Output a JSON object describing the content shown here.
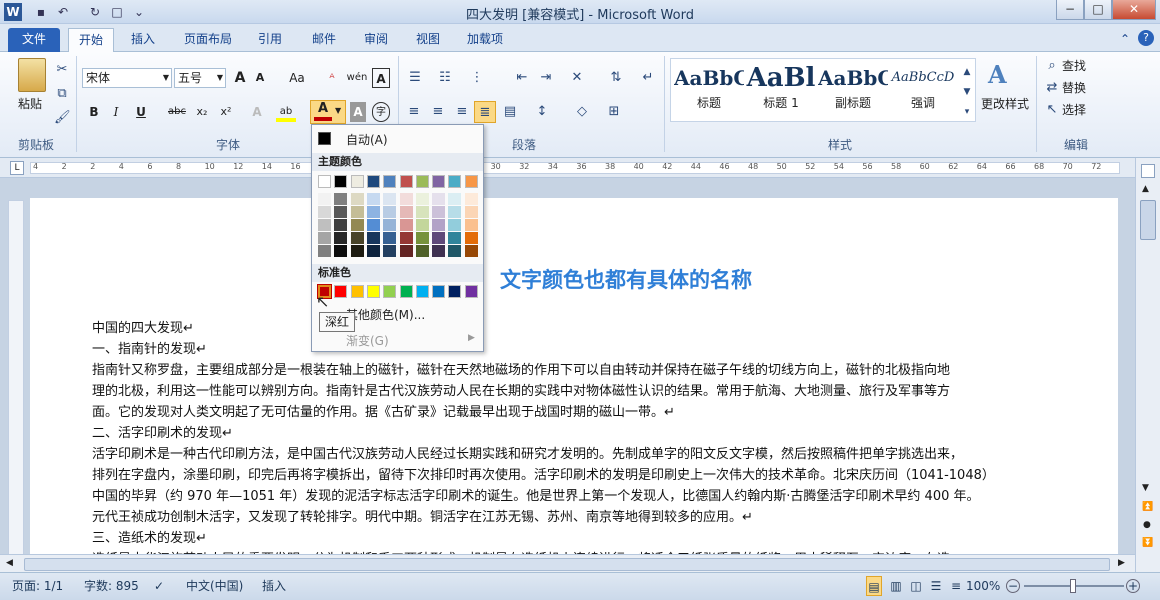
{
  "app": {
    "title": "四大发明 [兼容模式] - Microsoft Word",
    "word_icon": "W"
  },
  "quick_access": [
    "save-icon",
    "undo-icon",
    "redo-icon",
    "new-doc-icon",
    "customize-icon"
  ],
  "window_controls": {
    "minimize": "−",
    "maximize": "□",
    "close": "✕",
    "ribbon_min": "⌃",
    "help": "?"
  },
  "tabs": [
    "文件",
    "开始",
    "插入",
    "页面布局",
    "引用",
    "邮件",
    "审阅",
    "视图",
    "加载项"
  ],
  "ribbon": {
    "clipboard": {
      "label": "剪贴板",
      "paste": "粘贴"
    },
    "font": {
      "label": "字体",
      "font_name": "宋体",
      "font_size": "五号",
      "grow": "A",
      "shrink": "A",
      "change_case": "Aa",
      "clear": "ᴬ",
      "pinyin": "wén",
      "border_char": "A",
      "bold": "B",
      "italic": "I",
      "underline": "U",
      "strike": "abc",
      "sub": "x₂",
      "sup": "x²",
      "effects": "A",
      "highlight": "ab",
      "font_color": "A",
      "shading": "A",
      "enclosed": "字"
    },
    "paragraph": {
      "label": "段落"
    },
    "styles": {
      "label": "样式",
      "items": [
        {
          "preview": "AaBbC",
          "name": "标题"
        },
        {
          "preview": "AaBl",
          "name": "标题 1"
        },
        {
          "preview": "AaBbC",
          "name": "副标题"
        },
        {
          "preview": "AaBbCcD",
          "name": "强调"
        }
      ],
      "change_styles": "更改样式"
    },
    "editing": {
      "label": "编辑",
      "find": "查找",
      "replace": "替换",
      "select": "选择"
    }
  },
  "ruler": {
    "ticks": [
      "4",
      "2",
      "2",
      "4",
      "6",
      "8",
      "10",
      "12",
      "14",
      "16",
      "18",
      "20",
      "22",
      "24",
      "26",
      "28",
      "30",
      "32",
      "34",
      "36",
      "38",
      "40",
      "42",
      "44",
      "46",
      "48",
      "50",
      "52",
      "54",
      "56",
      "58",
      "60",
      "62",
      "64",
      "66",
      "68",
      "70",
      "72"
    ]
  },
  "color_menu": {
    "auto": "自动(A)",
    "theme_title": "主题颜色",
    "theme_colors": [
      "#ffffff",
      "#000000",
      "#eeece1",
      "#1f497d",
      "#4f81bd",
      "#c0504d",
      "#9bbb59",
      "#8064a2",
      "#4bacc6",
      "#f79646"
    ],
    "shades": [
      [
        "#f2f2f2",
        "#d8d8d8",
        "#bfbfbf",
        "#a5a5a5",
        "#7f7f7f"
      ],
      [
        "#7f7f7f",
        "#595959",
        "#3f3f3f",
        "#262626",
        "#0c0c0c"
      ],
      [
        "#ddd9c3",
        "#c4bd97",
        "#938953",
        "#494429",
        "#1d1b10"
      ],
      [
        "#c6d9f0",
        "#8db3e2",
        "#548dd4",
        "#17365d",
        "#0f243e"
      ],
      [
        "#dbe5f1",
        "#b8cce4",
        "#95b3d7",
        "#366092",
        "#244061"
      ],
      [
        "#f2dcdb",
        "#e5b9b7",
        "#d99694",
        "#953734",
        "#632423"
      ],
      [
        "#ebf1dd",
        "#d7e3bc",
        "#c3d69b",
        "#76923c",
        "#4f6128"
      ],
      [
        "#e5e0ec",
        "#ccc1d9",
        "#b2a2c7",
        "#5f497a",
        "#3f3151"
      ],
      [
        "#dbeef3",
        "#b7dde8",
        "#92cddc",
        "#31859b",
        "#205867"
      ],
      [
        "#fdeada",
        "#fbd5b5",
        "#fac08f",
        "#e36c09",
        "#974806"
      ]
    ],
    "standard_title": "标准色",
    "standard_colors": [
      "#c00000",
      "#ff0000",
      "#ffc000",
      "#ffff00",
      "#92d050",
      "#00b050",
      "#00b0f0",
      "#0070c0",
      "#002060",
      "#7030a0"
    ],
    "more": "其他颜色(M)...",
    "gradient": "渐变(G)",
    "tooltip": "深红"
  },
  "document": {
    "heading": "文字颜色也都有具体的名称",
    "lines": [
      "中国的四大发现↵",
      "一、指南针的发现↵",
      "指南针又称罗盘，主要组成部分是一根装在轴上的磁针，磁针在天然地磁场的作用下可以自由转动并保持在磁子午线的切线方向上，磁针的北极指向地",
      "理的北极，利用这一性能可以辨别方向。指南针是古代汉族劳动人民在长期的实践中对物体磁性认识的结果。常用于航海、大地测量、旅行及军事等方",
      "面。它的发现对人类文明起了无可估量的作用。据《古矿录》记载最早出现于战国时期的磁山一带。↵",
      "二、活字印刷术的发现↵",
      "活字印刷术是一种古代印刷方法，是中国古代汉族劳动人民经过长期实践和研究才发明的。先制成单字的阳文反文字模，然后按照稿件把单字挑选出来，",
      "排列在字盘内，涂墨印刷，印完后再将字模拆出，留待下次排印时再次使用。活字印刷术的发明是印刷史上一次伟大的技术革命。北宋庆历间（1041-1048）",
      "中国的毕昇（约 970 年—1051 年）发现的泥活字标志活字印刷术的诞生。他是世界上第一个发现人，比德国人约翰内斯·古腾堡活字印刷术早约 400 年。",
      "元代王祯成功创制木活字，又发现了转轮排字。明代中期。铜活字在江苏无锡、苏州、南京等地得到较多的应用。↵",
      "三、造纸术的发现↵",
      "造纸是中华汉族劳动人民的重要发明。分为机制和手工两种形式。机制是在造纸机上连续进行，将适合于纸张质量的纸浆，用水稀释至一定浓度，在造"
    ]
  },
  "status": {
    "page": "页面: 1/1",
    "words": "字数: 895",
    "lang": "中文(中国)",
    "mode": "插入",
    "zoom": "100%"
  }
}
